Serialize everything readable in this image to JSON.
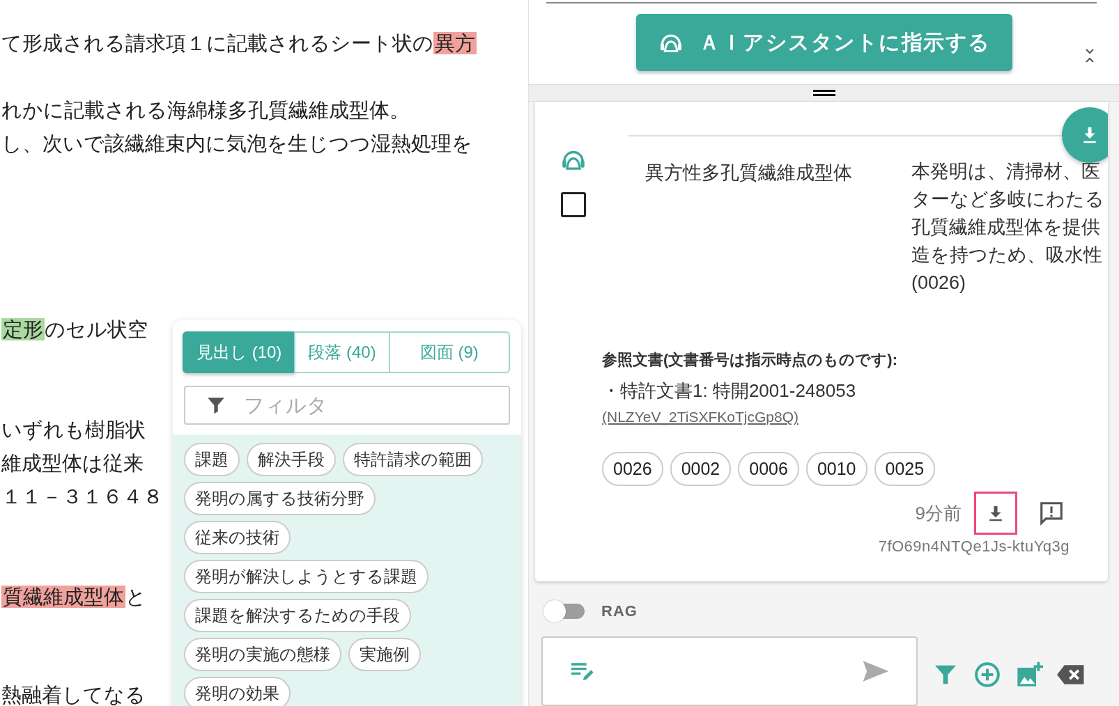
{
  "document": {
    "lines": [
      {
        "segments": [
          {
            "text": "て形成される請求項１に記載されるシート状の"
          },
          {
            "text": "異方",
            "color": "#f0a19b"
          }
        ]
      },
      {
        "segments": [
          {
            "text": "れかに記載される海綿様多孔質繊維成型体。"
          }
        ]
      },
      {
        "segments": [
          {
            "text": "し、次いで該繊維束内に気泡を生じつつ湿熱処理を"
          }
        ]
      },
      {
        "segments": [
          {
            "text": "定形",
            "color": "#a9d8a0"
          },
          {
            "text": "のセル状空"
          }
        ]
      },
      {
        "segments": [
          {
            "text": "いずれも樹脂状"
          }
        ]
      },
      {
        "segments": [
          {
            "text": "維成型体は従来"
          }
        ]
      },
      {
        "segments": [
          {
            "text": "１１－３１６４８"
          }
        ]
      },
      {
        "segments": [
          {
            "text": "質繊維成型体",
            "color": "#f0a19b"
          },
          {
            "text": "と"
          }
        ]
      },
      {
        "segments": [
          {
            "text": "熱融着してなる"
          }
        ]
      }
    ]
  },
  "heading_popup": {
    "tabs": [
      {
        "label": "見出し (10)",
        "selected": true
      },
      {
        "label": "段落 (40)",
        "selected": false
      },
      {
        "label": "図面 (9)",
        "selected": false
      }
    ],
    "filter": {
      "placeholder": "フィルタ"
    },
    "chip_rows": [
      [
        "課題",
        "解決手段",
        "特許請求の範囲"
      ],
      [
        "発明の属する技術分野"
      ],
      [
        "従来の技術"
      ],
      [
        "発明が解決しようとする課題"
      ],
      [
        "課題を解決するための手段"
      ],
      [
        "発明の実施の態様",
        "実施例"
      ],
      [
        "発明の効果"
      ]
    ]
  },
  "assistant": {
    "button": "ＡＩアシスタントに指示する",
    "result": {
      "checked": false,
      "title": "異方性多孔質繊維成型体",
      "summary_lines": [
        "本発明は、清掃材、医",
        "ターなど多岐にわたる",
        "孔質繊維成型体を提供",
        "造を持つため、吸水性",
        "(0026)"
      ],
      "references": {
        "heading": "参照文書(文書番号は指示時点のものです):",
        "item": "・特許文書1: 特開2001-248053",
        "link": "(NLZYeV_2TiSXFKoTjcGp8Q)"
      },
      "paragraphs": [
        "0026",
        "0002",
        "0006",
        "0010",
        "0025"
      ],
      "time": "9分前",
      "download_focused": true,
      "id": "7fO69n4NTQe1Js-ktuYq3g"
    },
    "rag": {
      "label": "RAG",
      "on": false
    }
  }
}
